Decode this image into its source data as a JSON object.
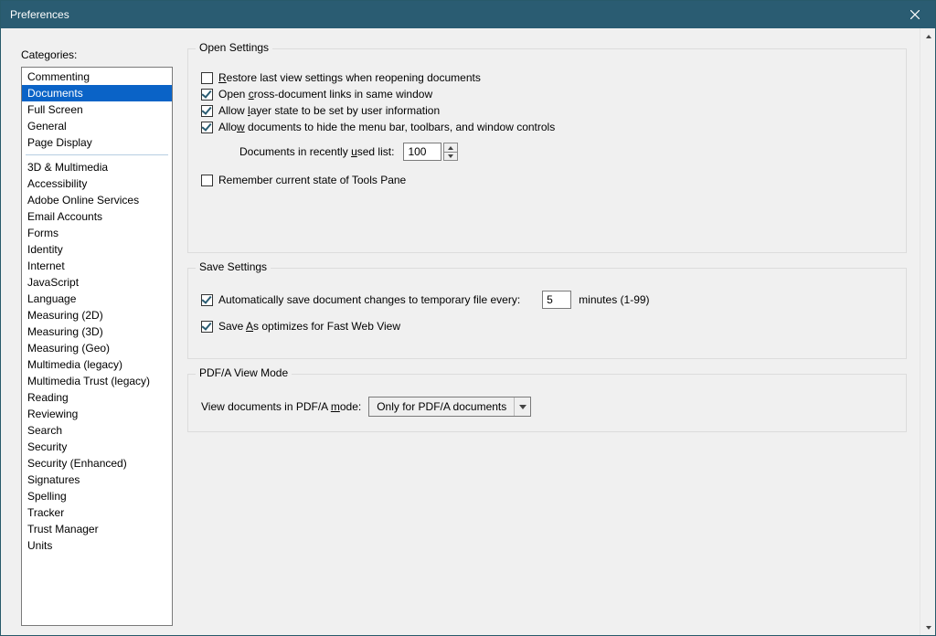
{
  "window": {
    "title": "Preferences"
  },
  "sidebar": {
    "label": "Categories:",
    "group1": [
      "Commenting",
      "Documents",
      "Full Screen",
      "General",
      "Page Display"
    ],
    "selected_index": 1,
    "group2": [
      "3D & Multimedia",
      "Accessibility",
      "Adobe Online Services",
      "Email Accounts",
      "Forms",
      "Identity",
      "Internet",
      "JavaScript",
      "Language",
      "Measuring (2D)",
      "Measuring (3D)",
      "Measuring (Geo)",
      "Multimedia (legacy)",
      "Multimedia Trust (legacy)",
      "Reading",
      "Reviewing",
      "Search",
      "Security",
      "Security (Enhanced)",
      "Signatures",
      "Spelling",
      "Tracker",
      "Trust Manager",
      "Units"
    ]
  },
  "open_settings": {
    "legend": "Open Settings",
    "restore": {
      "pre": "",
      "u": "R",
      "post": "estore last view settings when reopening documents",
      "checked": false
    },
    "cross": {
      "pre": "Open ",
      "u": "c",
      "post": "ross-document links in same window",
      "checked": true
    },
    "layer": {
      "pre": "Allow ",
      "u": "l",
      "post": "ayer state to be set by user information",
      "checked": true
    },
    "hidemenu": {
      "pre": "Allo",
      "u": "w",
      "post": " documents to hide the menu bar, toolbars, and window controls",
      "checked": true
    },
    "recent": {
      "pre": "Documents in recently ",
      "u": "u",
      "post": "sed list:",
      "value": "100"
    },
    "remember_tools": {
      "label": "Remember current state of Tools Pane",
      "checked": false
    }
  },
  "save_settings": {
    "legend": "Save Settings",
    "autosave": {
      "label": "Automatically save document changes to temporary file every:",
      "checked": true,
      "value": "5",
      "unit": "minutes (1-99)"
    },
    "fastweb": {
      "pre": "Save ",
      "u": "A",
      "post": "s optimizes for Fast Web View",
      "checked": true
    }
  },
  "pdfa": {
    "legend": "PDF/A View Mode",
    "label_pre": "View documents in PDF/A ",
    "label_u": "m",
    "label_post": "ode:",
    "value": "Only for PDF/A documents"
  }
}
